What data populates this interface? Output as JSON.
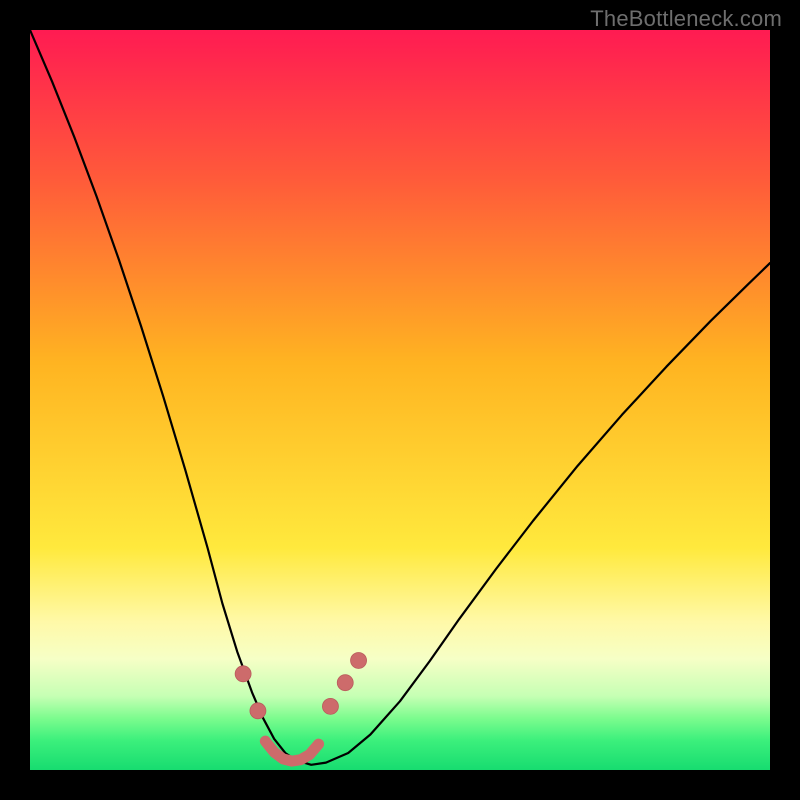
{
  "watermark": "TheBottleneck.com",
  "chart_data": {
    "type": "line",
    "title": "",
    "xlabel": "",
    "ylabel": "",
    "xlim": [
      0,
      100
    ],
    "ylim": [
      0,
      100
    ],
    "grid": false,
    "background_gradient": {
      "stops": [
        {
          "offset": 0.0,
          "color": "#ff1b52"
        },
        {
          "offset": 0.2,
          "color": "#ff5a3a"
        },
        {
          "offset": 0.45,
          "color": "#ffb421"
        },
        {
          "offset": 0.7,
          "color": "#ffe93d"
        },
        {
          "offset": 0.8,
          "color": "#fff9a8"
        },
        {
          "offset": 0.85,
          "color": "#f6ffc6"
        },
        {
          "offset": 0.9,
          "color": "#c6ffb4"
        },
        {
          "offset": 0.93,
          "color": "#7cfc8e"
        },
        {
          "offset": 0.96,
          "color": "#3cf07c"
        },
        {
          "offset": 1.0,
          "color": "#17dc70"
        }
      ]
    },
    "series": [
      {
        "name": "bottleneck-curve",
        "stroke": "#000000",
        "stroke_width": 2.2,
        "x": [
          0,
          3,
          6,
          9,
          12,
          15,
          18,
          21,
          24,
          26,
          28,
          30,
          31.5,
          33,
          34.5,
          36,
          38,
          40,
          43,
          46,
          50,
          54,
          58,
          63,
          68,
          74,
          80,
          86,
          92,
          97,
          100
        ],
        "y": [
          100,
          93,
          85.5,
          77.5,
          69,
          60,
          50.5,
          40.5,
          30,
          22.5,
          16,
          10.5,
          7,
          4.2,
          2.3,
          1.3,
          0.7,
          1.0,
          2.3,
          4.8,
          9.3,
          14.7,
          20.4,
          27.2,
          33.7,
          41.1,
          48.0,
          54.5,
          60.7,
          65.6,
          68.5
        ]
      }
    ],
    "markers": {
      "name": "curve-markers",
      "fill": "#cd6b6b",
      "stroke": "#b95c5c",
      "stroke_width": 0.8,
      "radius": 8,
      "points": [
        {
          "x": 28.8,
          "y": 13.0
        },
        {
          "x": 30.8,
          "y": 8.0
        },
        {
          "x": 40.6,
          "y": 8.6
        },
        {
          "x": 42.6,
          "y": 11.8
        },
        {
          "x": 44.4,
          "y": 14.8
        }
      ]
    },
    "bottom_trace": {
      "name": "bottom-trace",
      "stroke": "#cd6b6b",
      "stroke_width": 11,
      "x": [
        31.8,
        33.0,
        34.2,
        35.4,
        36.6,
        37.8,
        39.0
      ],
      "y": [
        3.9,
        2.4,
        1.5,
        1.2,
        1.4,
        2.1,
        3.5
      ]
    }
  }
}
